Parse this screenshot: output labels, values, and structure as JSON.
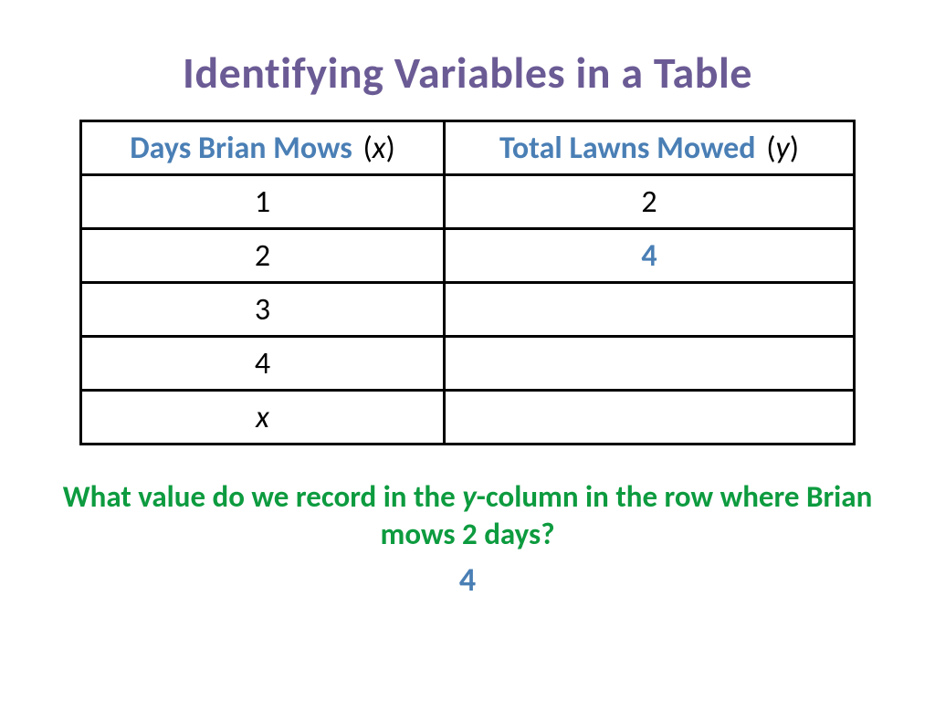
{
  "title": "Identifying Variables in a Table",
  "table": {
    "headers": {
      "col1_label": "Days Brian Mows",
      "col1_var": "x",
      "col2_label": "Total Lawns Mowed",
      "col2_var": "y"
    },
    "rows": [
      {
        "x": "1",
        "y": "2",
        "y_highlight": false,
        "x_italic": false
      },
      {
        "x": "2",
        "y": "4",
        "y_highlight": true,
        "x_italic": false
      },
      {
        "x": "3",
        "y": "",
        "y_highlight": false,
        "x_italic": false
      },
      {
        "x": "4",
        "y": "",
        "y_highlight": false,
        "x_italic": false
      },
      {
        "x": "x",
        "y": "",
        "y_highlight": false,
        "x_italic": true
      }
    ]
  },
  "question": {
    "part1": "What value do we record in the ",
    "var": "y",
    "part2": "-column in the row where Brian mows 2 days?"
  },
  "answer": "4"
}
